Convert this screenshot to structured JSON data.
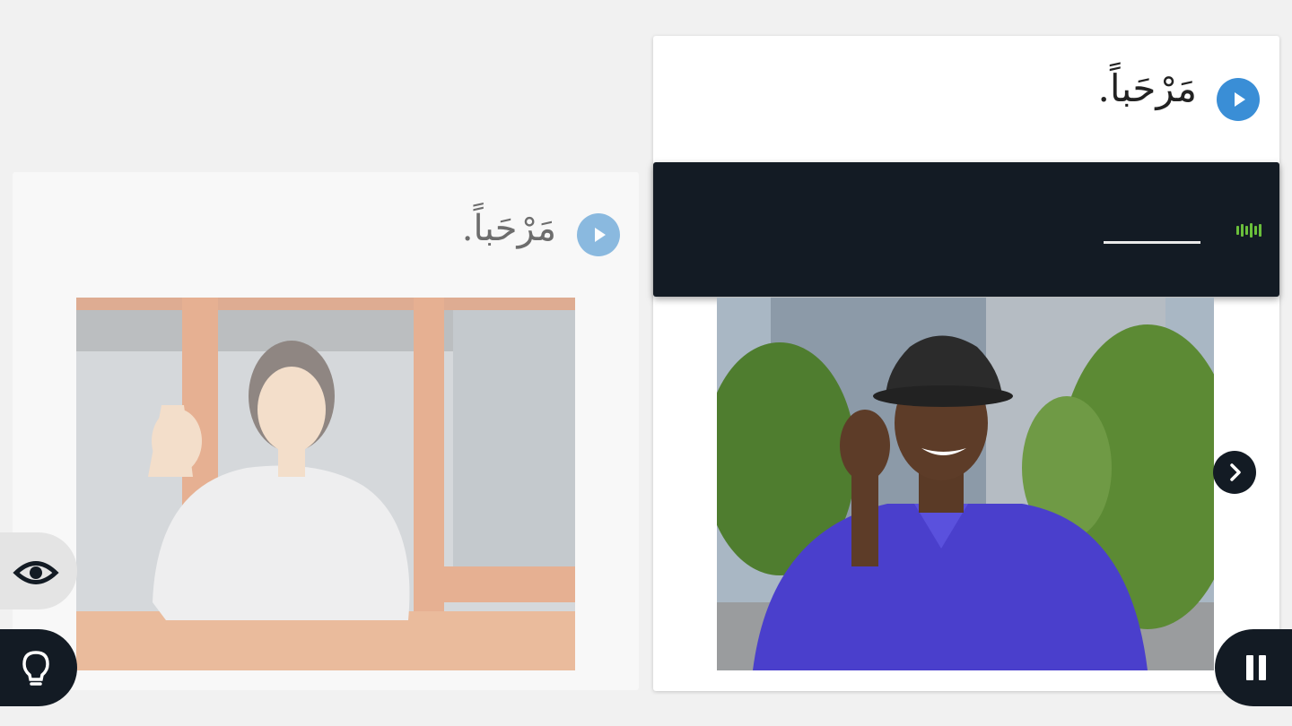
{
  "previous_card": {
    "phrase": "مَرْحَباً.",
    "play_icon": "play-icon",
    "image_description": "woman-waving-window"
  },
  "current_card": {
    "phrase": "مَرْحَباً.",
    "play_icon": "play-icon",
    "answer": {
      "value": "",
      "mic_icon": "microphone-level-icon"
    },
    "image_description": "man-in-hat-blue-shirt"
  },
  "controls": {
    "next_icon": "chevron-right-icon",
    "eye_icon": "eye-icon",
    "hint_icon": "lightbulb-icon",
    "pause_icon": "pause-icon"
  },
  "colors": {
    "accent_blue": "#3a8ed6",
    "dark_navy": "#131b24",
    "mic_green": "#6abf3b",
    "background": "#f1f1f1"
  }
}
